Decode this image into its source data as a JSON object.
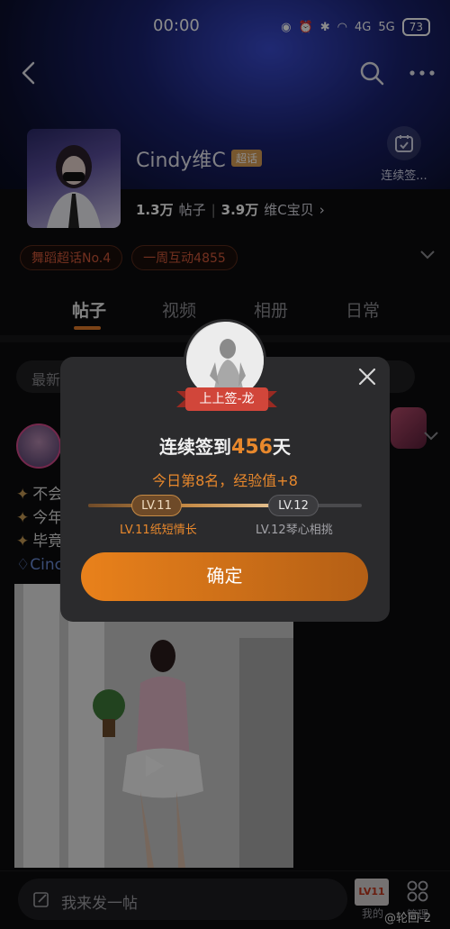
{
  "status_bar": {
    "time": "00:00",
    "battery": "73",
    "signal_1": "4G",
    "signal_2": "5G"
  },
  "header": {
    "name": "Cindy维C",
    "super_tag": "超话",
    "checkin_label": "连续签...",
    "stats": {
      "posts_count": "1.3万",
      "posts_label": "帖子",
      "fans_count": "3.9万",
      "fans_label": "维C宝贝",
      "fans_arrow": "›"
    }
  },
  "tags": [
    "舞蹈超话No.4",
    "一周互动4855"
  ],
  "tabs": [
    {
      "label": "帖子",
      "active": true
    },
    {
      "label": "视频",
      "active": false
    },
    {
      "label": "相册",
      "active": false
    },
    {
      "label": "日常",
      "active": false
    }
  ],
  "feed": {
    "search_text": "最新",
    "post_lines": [
      "不会",
      "今年",
      "毕竟"
    ],
    "post_link": "Cinc"
  },
  "bottom": {
    "compose_placeholder": "我来发一帖",
    "my_level_badge": "LV11",
    "my_label": "我的",
    "manage_label": "管理",
    "watermark": "@轮回-2"
  },
  "modal": {
    "ribbon_text": "上上签-龙",
    "title_prefix": "连续签到",
    "title_days": "456",
    "title_suffix": "天",
    "subtitle": "今日第8名，经验值+8",
    "current_level": "LV.11",
    "current_level_caption": "LV.11纸短情长",
    "next_level": "LV.12",
    "next_level_caption": "LV.12琴心相挑",
    "progress_fraction": 0.72,
    "confirm_label": "确定"
  },
  "colors": {
    "accent_orange": "#e8882c",
    "tag_red": "#d0583a",
    "modal_bg": "#2b2b2d"
  }
}
